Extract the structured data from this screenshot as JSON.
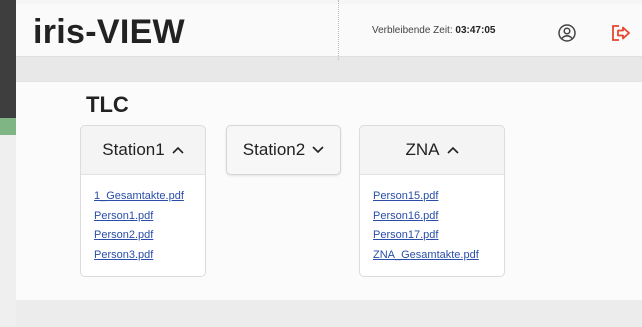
{
  "header": {
    "logo_text": "iris-VIEW",
    "timer_label": "Verbleibende Zeit:",
    "timer_value": "03:47:05",
    "icons": [
      "user-icon",
      "logout-icon"
    ],
    "accent_color": "#e8442f"
  },
  "main": {
    "section_title": "TLC",
    "dropdowns": [
      {
        "label": "Station1",
        "expanded": true,
        "files": [
          "1_Gesamtakte.pdf",
          "Person1.pdf",
          "Person2.pdf",
          "Person3.pdf"
        ]
      },
      {
        "label": "Station2",
        "expanded": false,
        "files": []
      },
      {
        "label": "ZNA",
        "expanded": true,
        "files": [
          "Person15.pdf",
          "Person16.pdf",
          "Person17.pdf",
          "ZNA_Gesamtakte.pdf"
        ]
      }
    ]
  }
}
